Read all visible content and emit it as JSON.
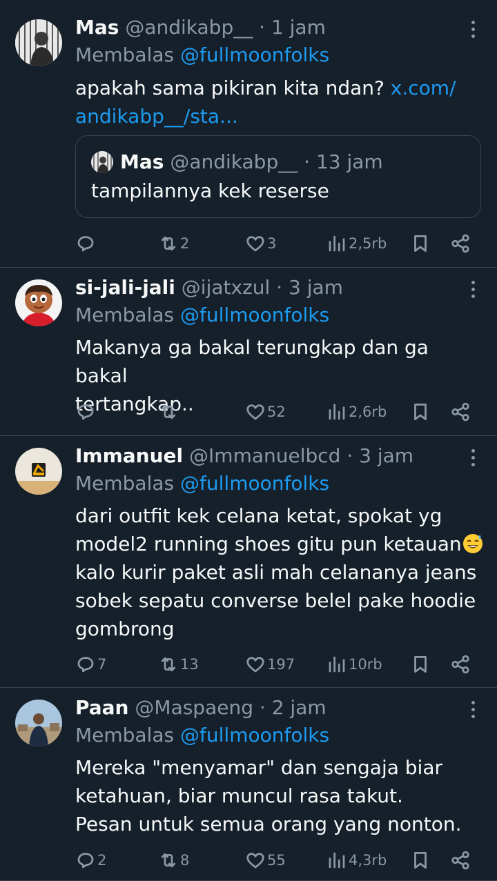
{
  "colors": {
    "background": "#15202b",
    "text": "#f7f9f9",
    "muted": "#8b98a5",
    "accent": "#1d9bf0",
    "divider": "#38444d"
  },
  "tweets": [
    {
      "name": "Mas",
      "handle": "@andikabp__",
      "time": "· 1 jam",
      "reply_prefix": "Membalas",
      "reply_to": "@fullmoonfolks",
      "text": "apakah sama pikiran kita ndan?",
      "link": "x.com/",
      "link2": "andikabp__/sta...",
      "quote": {
        "name": "Mas",
        "handle": "@andikabp__",
        "time": "· 13 jam",
        "text": "tampilannya kek reserse"
      },
      "stats": {
        "replies": "",
        "retweets": "2",
        "likes": "3",
        "views": "2,5rb"
      }
    },
    {
      "name": "si-jali-jali",
      "handle": "@ijatxzul",
      "time": "· 3 jam",
      "reply_prefix": "Membalas",
      "reply_to": "@fullmoonfolks",
      "line1": "Makanya ga bakal terungkap dan ga bakal",
      "line2": "tertangkap..",
      "stats": {
        "replies": "",
        "retweets": "",
        "likes": "52",
        "views": "2,6rb"
      }
    },
    {
      "name": "Immanuel",
      "handle": "@Immanuelbcd",
      "time": "· 3 jam",
      "reply_prefix": "Membalas",
      "reply_to": "@fullmoonfolks",
      "line1": "dari outfit kek celana ketat, spokat yg",
      "line2": "model2 running shoes gitu pun ketauan",
      "emoji": "sweat-smile-emoji",
      "line3": "kalo kurir paket asli mah celananya jeans",
      "line4": "sobek sepatu converse belel pake hoodie",
      "line5": "gombrong",
      "stats": {
        "replies": "7",
        "retweets": "13",
        "likes": "197",
        "views": "10rb"
      }
    },
    {
      "name": "Paan",
      "handle": "@Maspaeng",
      "time": "· 2 jam",
      "reply_prefix": "Membalas",
      "reply_to": "@fullmoonfolks",
      "line1": "Mereka \"menyamar\" dan sengaja biar",
      "line2": "ketahuan, biar muncul rasa takut.",
      "line3": "Pesan untuk semua orang yang nonton.",
      "stats": {
        "replies": "2",
        "retweets": "8",
        "likes": "55",
        "views": "4,3rb"
      }
    }
  ]
}
